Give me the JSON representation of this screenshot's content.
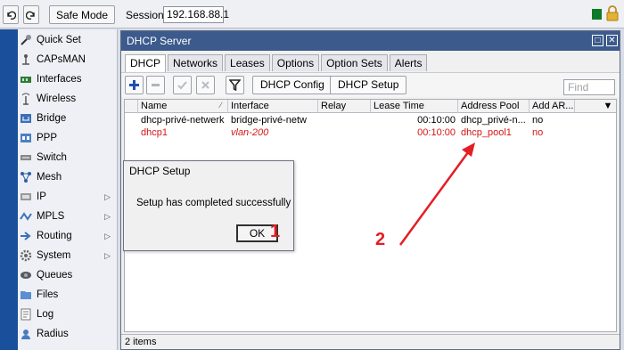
{
  "toolbar": {
    "undo_icon": "undo-icon",
    "redo_icon": "redo-icon",
    "safe_mode_label": "Safe Mode",
    "session_label": "Session:",
    "session_value": "192.168.88.1"
  },
  "sidebar": {
    "items": [
      {
        "label": "Quick Set",
        "icon": "quick-set-icon"
      },
      {
        "label": "CAPsMAN",
        "icon": "capsman-icon"
      },
      {
        "label": "Interfaces",
        "icon": "interfaces-icon"
      },
      {
        "label": "Wireless",
        "icon": "wireless-icon"
      },
      {
        "label": "Bridge",
        "icon": "bridge-icon"
      },
      {
        "label": "PPP",
        "icon": "ppp-icon"
      },
      {
        "label": "Switch",
        "icon": "switch-icon"
      },
      {
        "label": "Mesh",
        "icon": "mesh-icon"
      },
      {
        "label": "IP",
        "icon": "ip-icon"
      },
      {
        "label": "MPLS",
        "icon": "mpls-icon"
      },
      {
        "label": "Routing",
        "icon": "routing-icon"
      },
      {
        "label": "System",
        "icon": "system-icon"
      },
      {
        "label": "Queues",
        "icon": "queues-icon"
      },
      {
        "label": "Files",
        "icon": "files-icon"
      },
      {
        "label": "Log",
        "icon": "log-icon"
      },
      {
        "label": "Radius",
        "icon": "radius-icon"
      }
    ]
  },
  "window": {
    "title": "DHCP Server",
    "tabs": [
      "DHCP",
      "Networks",
      "Leases",
      "Options",
      "Option Sets",
      "Alerts"
    ],
    "buttons": {
      "dhcp_config": "DHCP Config",
      "dhcp_setup": "DHCP Setup"
    },
    "find_placeholder": "Find",
    "columns": [
      "Name",
      "Interface",
      "Relay",
      "Lease Time",
      "Address Pool",
      "Add AR..."
    ],
    "rows": [
      {
        "name": "dhcp-privé-netwerk",
        "interface": "bridge-privé-netw",
        "relay": "",
        "lease_time": "00:10:00",
        "pool": "dhcp_privé-n...",
        "add_arp": "no",
        "disabled": false
      },
      {
        "name": "dhcp1",
        "interface": "vlan-200",
        "relay": "",
        "lease_time": "00:10:00",
        "pool": "dhcp_pool1",
        "add_arp": "no",
        "disabled": true
      }
    ],
    "status": "2 items"
  },
  "dialog": {
    "title": "DHCP Setup",
    "message": "Setup has completed successfully",
    "ok_label": "OK"
  },
  "annotations": {
    "one": "1",
    "two": "2"
  },
  "colors": {
    "accent": "#3c5a8c",
    "disabled_row": "#d41515",
    "annotation": "#e31e24"
  }
}
